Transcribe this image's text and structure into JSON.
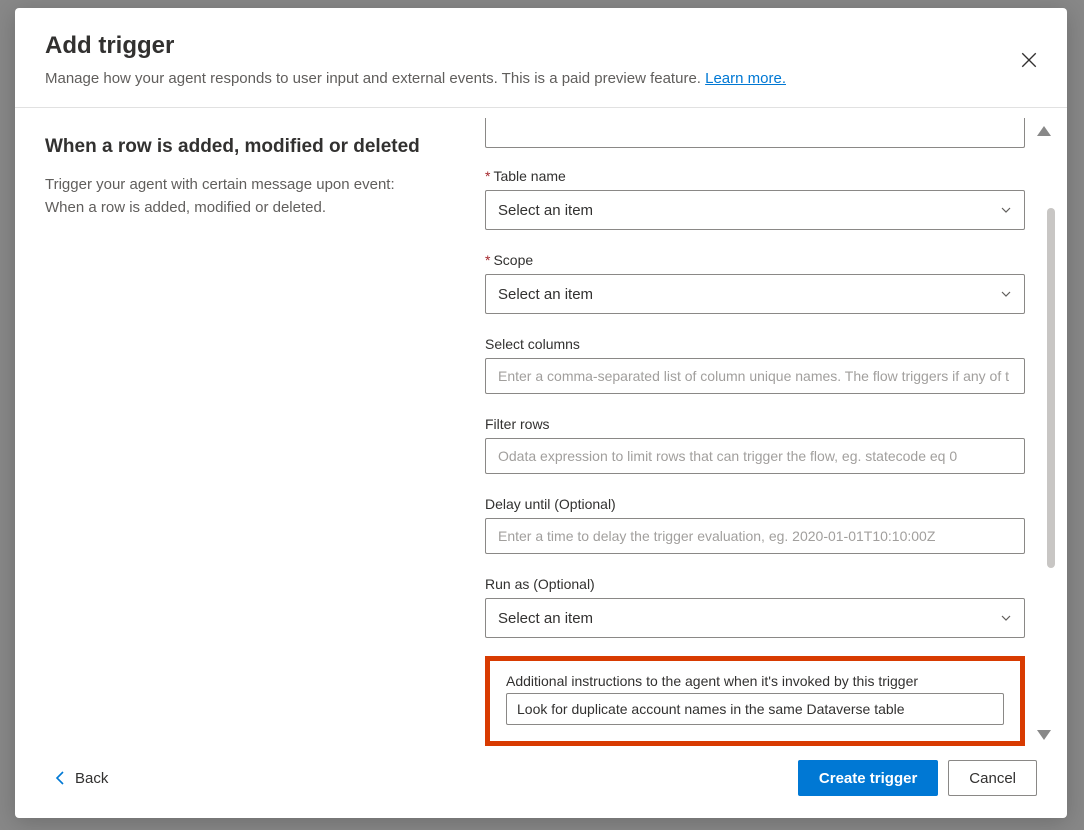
{
  "header": {
    "title": "Add trigger",
    "subtitle_pre": "Manage how your agent responds to user input and external events. This is a paid preview feature. ",
    "learn_more": "Learn more."
  },
  "left": {
    "title": "When a row is added, modified or deleted",
    "description": "Trigger your agent with certain message upon event: When a row is added, modified or deleted."
  },
  "form": {
    "table_name": {
      "label": "Table name",
      "value": "Select an item"
    },
    "scope": {
      "label": "Scope",
      "value": "Select an item"
    },
    "select_columns": {
      "label": "Select columns",
      "placeholder": "Enter a comma-separated list of column unique names. The flow triggers if any of t"
    },
    "filter_rows": {
      "label": "Filter rows",
      "placeholder": "Odata expression to limit rows that can trigger the flow, eg. statecode eq 0"
    },
    "delay_until": {
      "label": "Delay until (Optional)",
      "placeholder": "Enter a time to delay the trigger evaluation, eg. 2020-01-01T10:10:00Z"
    },
    "run_as": {
      "label": "Run as (Optional)",
      "value": "Select an item"
    },
    "instructions": {
      "label": "Additional instructions to the agent when it's invoked by this trigger",
      "value": "Look for duplicate account names in the same Dataverse table"
    }
  },
  "footer": {
    "back": "Back",
    "create": "Create trigger",
    "cancel": "Cancel"
  }
}
